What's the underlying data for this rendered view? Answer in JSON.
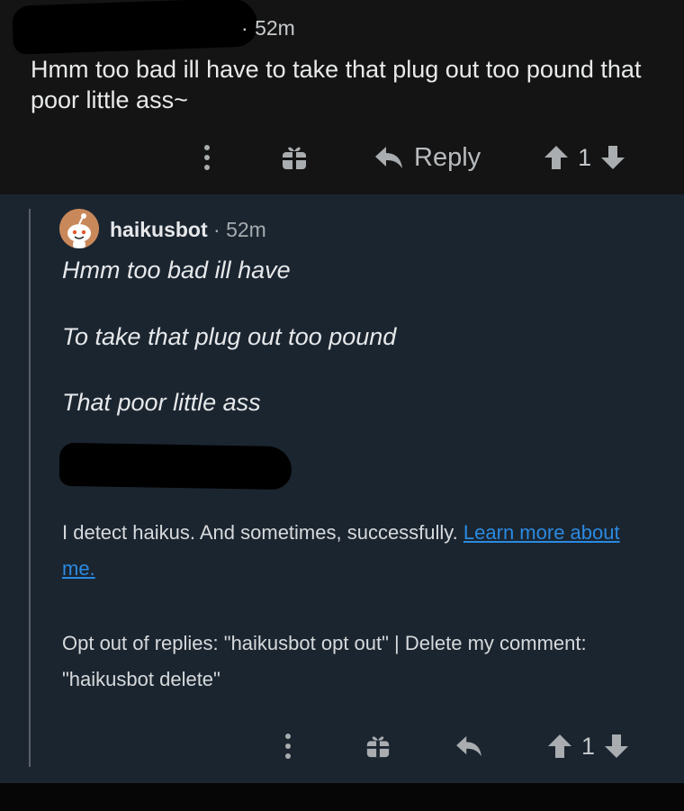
{
  "parent": {
    "time": "52m",
    "separator": "·",
    "body": "Hmm too bad ill have to take that plug out too pound that poor little ass~",
    "actions": {
      "more_icon": "more-vertical-icon",
      "award_icon": "gift-icon",
      "reply_icon": "reply-arrow-icon",
      "reply_label": "Reply",
      "upvote_icon": "arrow-up-icon",
      "score": "1",
      "downvote_icon": "arrow-down-icon"
    }
  },
  "reply": {
    "author": "haikusbot",
    "separator": "·",
    "time": "52m",
    "haiku": [
      "Hmm too bad ill have",
      "To take that plug out too pound",
      "That poor little ass"
    ],
    "bot_description": "I detect haikus. And sometimes, successfully.",
    "learn_more_link": "Learn more about me.",
    "opt_out_text": "Opt out of replies: \"haikusbot opt out\" | Delete my comment: \"haikusbot delete\"",
    "actions": {
      "more_icon": "more-vertical-icon",
      "award_icon": "gift-icon",
      "reply_icon": "reply-arrow-icon",
      "upvote_icon": "arrow-up-icon",
      "score": "1",
      "downvote_icon": "arrow-down-icon"
    }
  },
  "colors": {
    "parent_background": "#141414",
    "reply_background": "#1b2530",
    "link": "#2b8ae0",
    "text": "#d7dadc"
  }
}
